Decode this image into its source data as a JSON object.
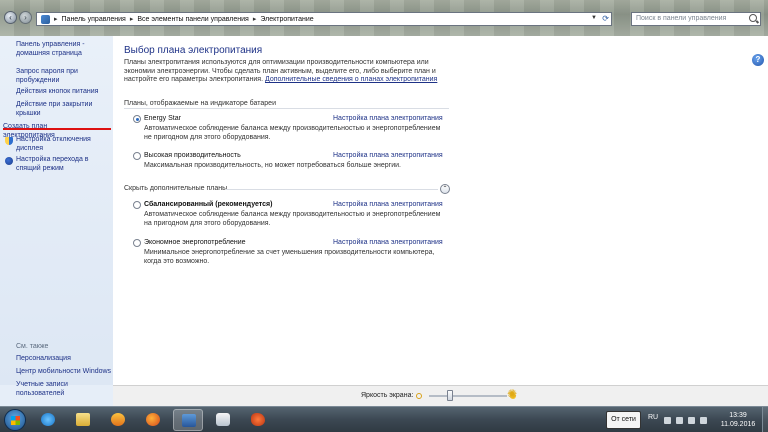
{
  "address_bar": {
    "crumbs": [
      "Панель управления",
      "Все элементы панели управления",
      "Электропитание"
    ],
    "search_placeholder": "Поиск в панели управления"
  },
  "left_pane": {
    "links": [
      "Панель управления - домашняя страница",
      "Запрос пароля при пробуждении",
      "Действия кнопок питания",
      "Действие при закрытии крышки",
      "Создать план электропитания",
      "Настройка отключения дисплея",
      "Настройка перехода в спящий режим"
    ],
    "see_also_label": "См. также",
    "see_also": [
      "Персонализация",
      "Центр мобильности Windows",
      "Учетные записи пользователей"
    ]
  },
  "main": {
    "title": "Выбор плана электропитания",
    "intro": "Планы электропитания используются для оптимизации производительности компьютера или экономии электроэнергии. Чтобы сделать план активным, выделите его, либо выберите план и настройте его параметры электропитания.",
    "intro_link": "Дополнительные сведения о планах электропитания",
    "group_battery": "Планы, отображаемые на индикаторе батареи",
    "group_hidden": "Скрыть дополнительные планы",
    "plan_link": "Настройка плана электропитания",
    "plans": [
      {
        "name": "Energy Star",
        "desc": "Автоматическое соблюдение баланса между производительностью и энергопотреблением не пригодном для этого оборудования.",
        "selected": true
      },
      {
        "name": "Высокая производительность",
        "desc": "Максимальная производительность, но может потребоваться больше энергии.",
        "selected": false
      },
      {
        "name": "Сбалансированный (рекомендуется)",
        "desc": "Автоматическое соблюдение баланса между производительностью и энергопотреблением на пригодном для этого оборудования.",
        "selected": false
      },
      {
        "name": "Экономное энергопотребление",
        "desc": "Минимальное энергопотребление за счет уменьшения производительности компьютера, когда это возможно.",
        "selected": false
      }
    ]
  },
  "status": {
    "brightness_label": "Яркость экрана:",
    "brightness_level": 0.27
  },
  "taskbar": {
    "offline_popup": "От сети",
    "lang": "RU",
    "time": "13:39",
    "date": "11.09.2016"
  },
  "colors": {
    "link": "#1e3287",
    "active_underline": "#dd1111",
    "left_pane_bg": "#dde7f4"
  }
}
